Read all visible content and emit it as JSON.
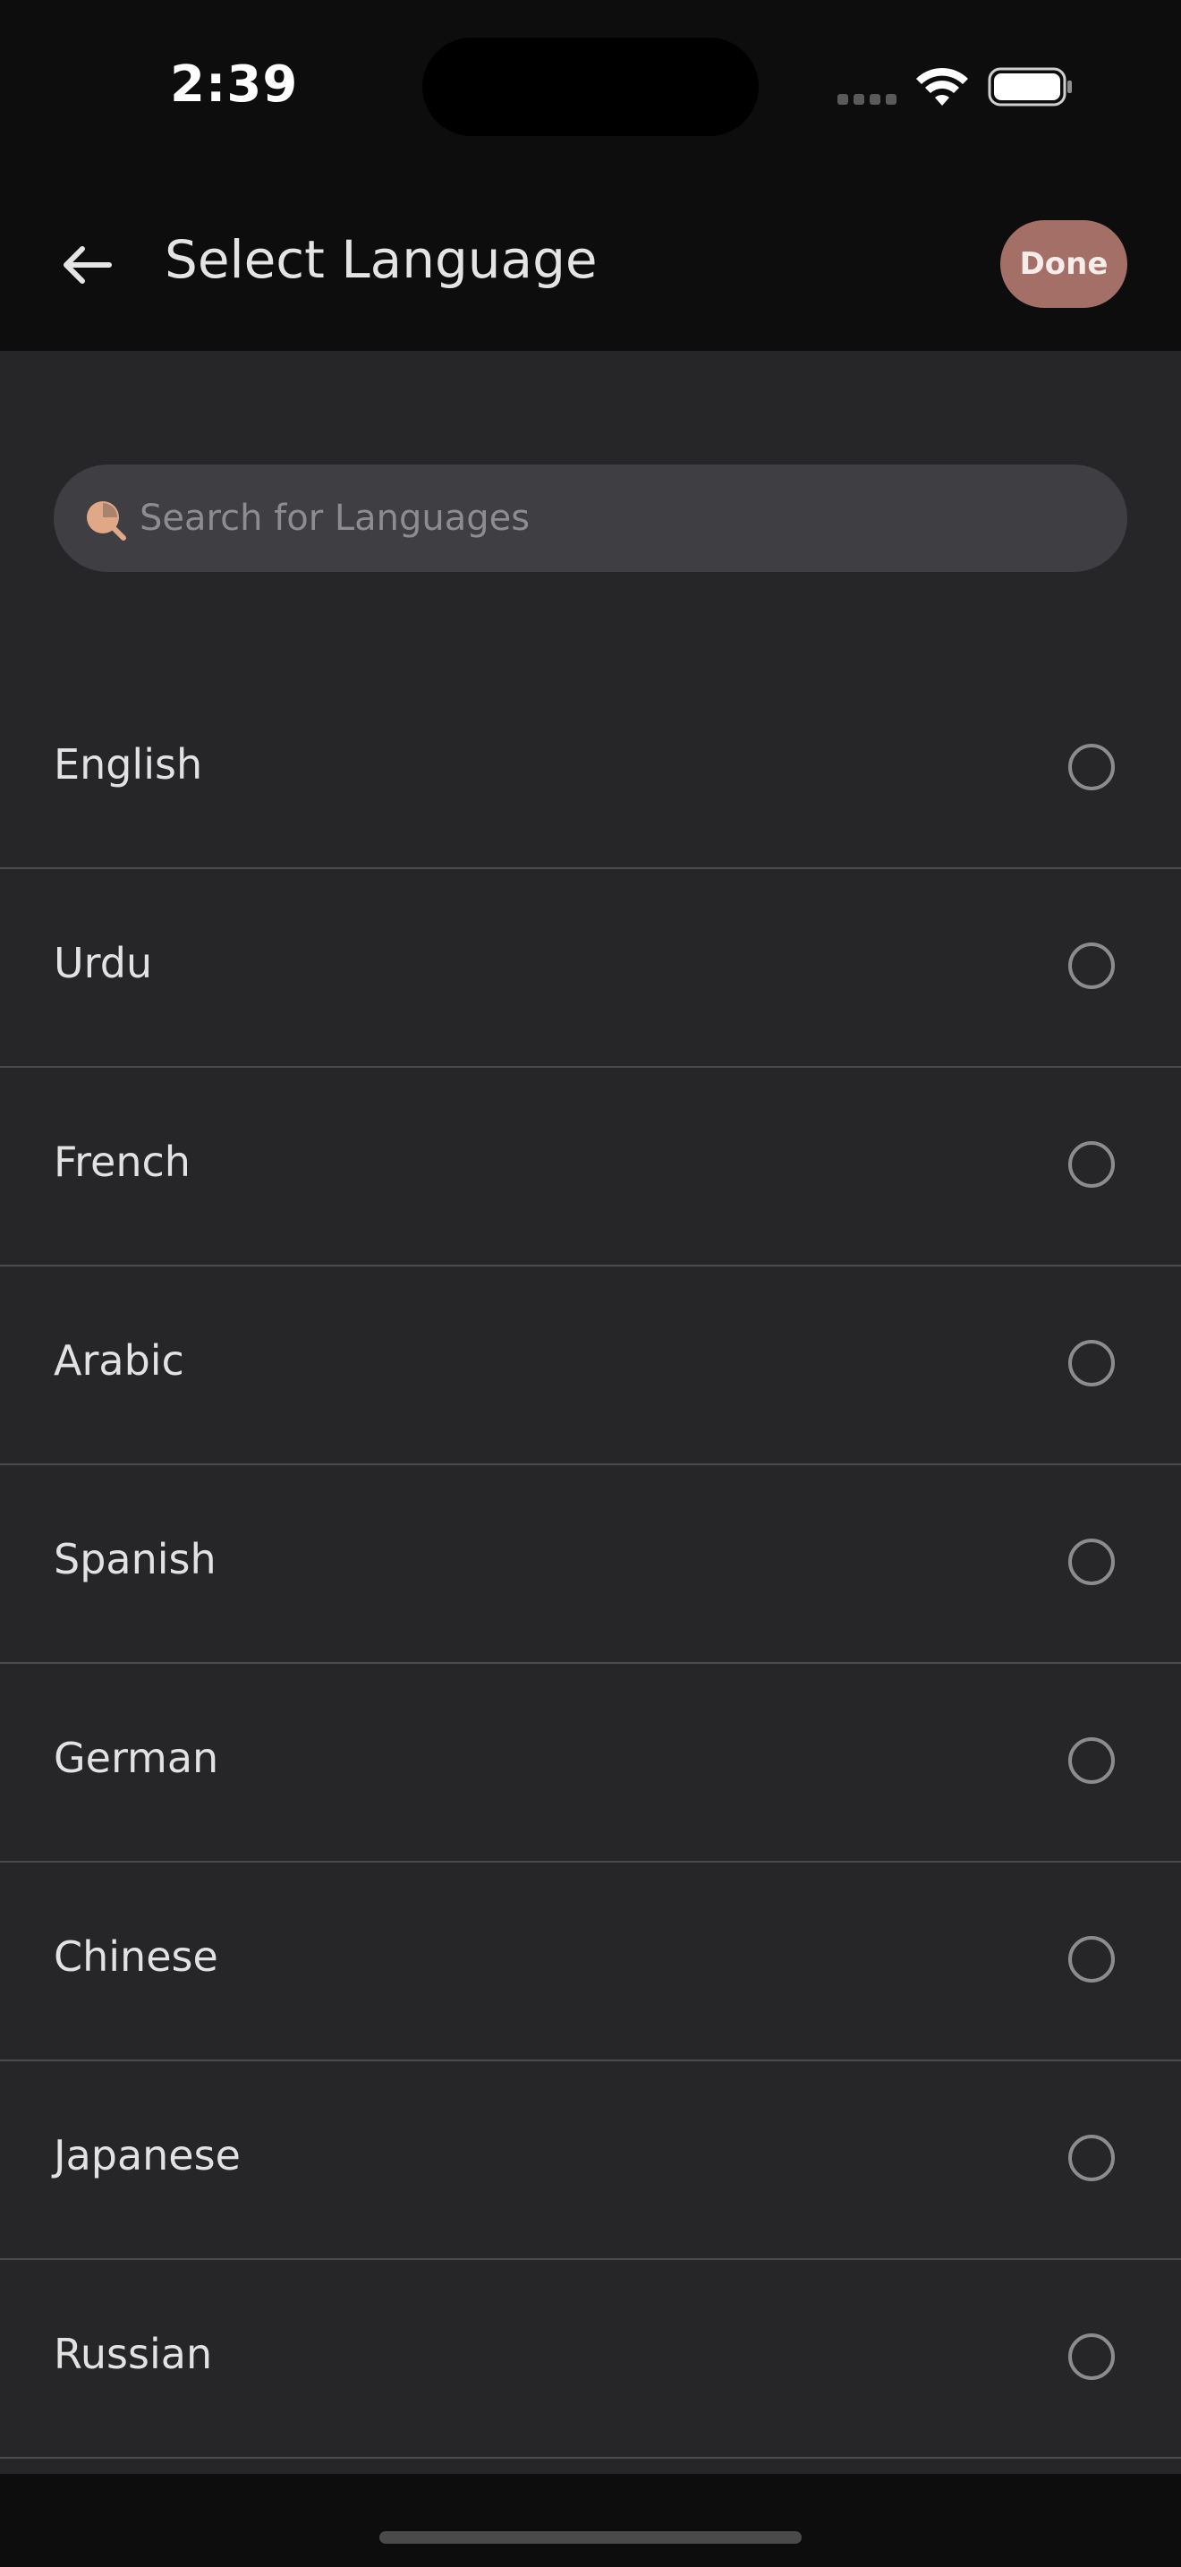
{
  "status_bar": {
    "time": "2:39",
    "icons": [
      "cellular-signal-icon",
      "wifi-icon",
      "battery-icon"
    ]
  },
  "header": {
    "back_icon": "arrow-left-icon",
    "title": "Select Language",
    "done_label": "Done"
  },
  "search": {
    "placeholder": "Search for Languages",
    "value": "",
    "icon": "search-icon"
  },
  "languages": [
    {
      "label": "English",
      "selected": false
    },
    {
      "label": "Urdu",
      "selected": false
    },
    {
      "label": "French",
      "selected": false
    },
    {
      "label": "Arabic",
      "selected": false
    },
    {
      "label": "Spanish",
      "selected": false
    },
    {
      "label": "German",
      "selected": false
    },
    {
      "label": "Chinese",
      "selected": false
    },
    {
      "label": "Japanese",
      "selected": false
    },
    {
      "label": "Russian",
      "selected": false
    }
  ],
  "colors": {
    "accent": "#a36f66",
    "search_icon": "#e0a886",
    "background": "#262628",
    "header_background": "#0d0d0d",
    "search_background": "#3f3e42",
    "divider": "#4b4b4e"
  }
}
